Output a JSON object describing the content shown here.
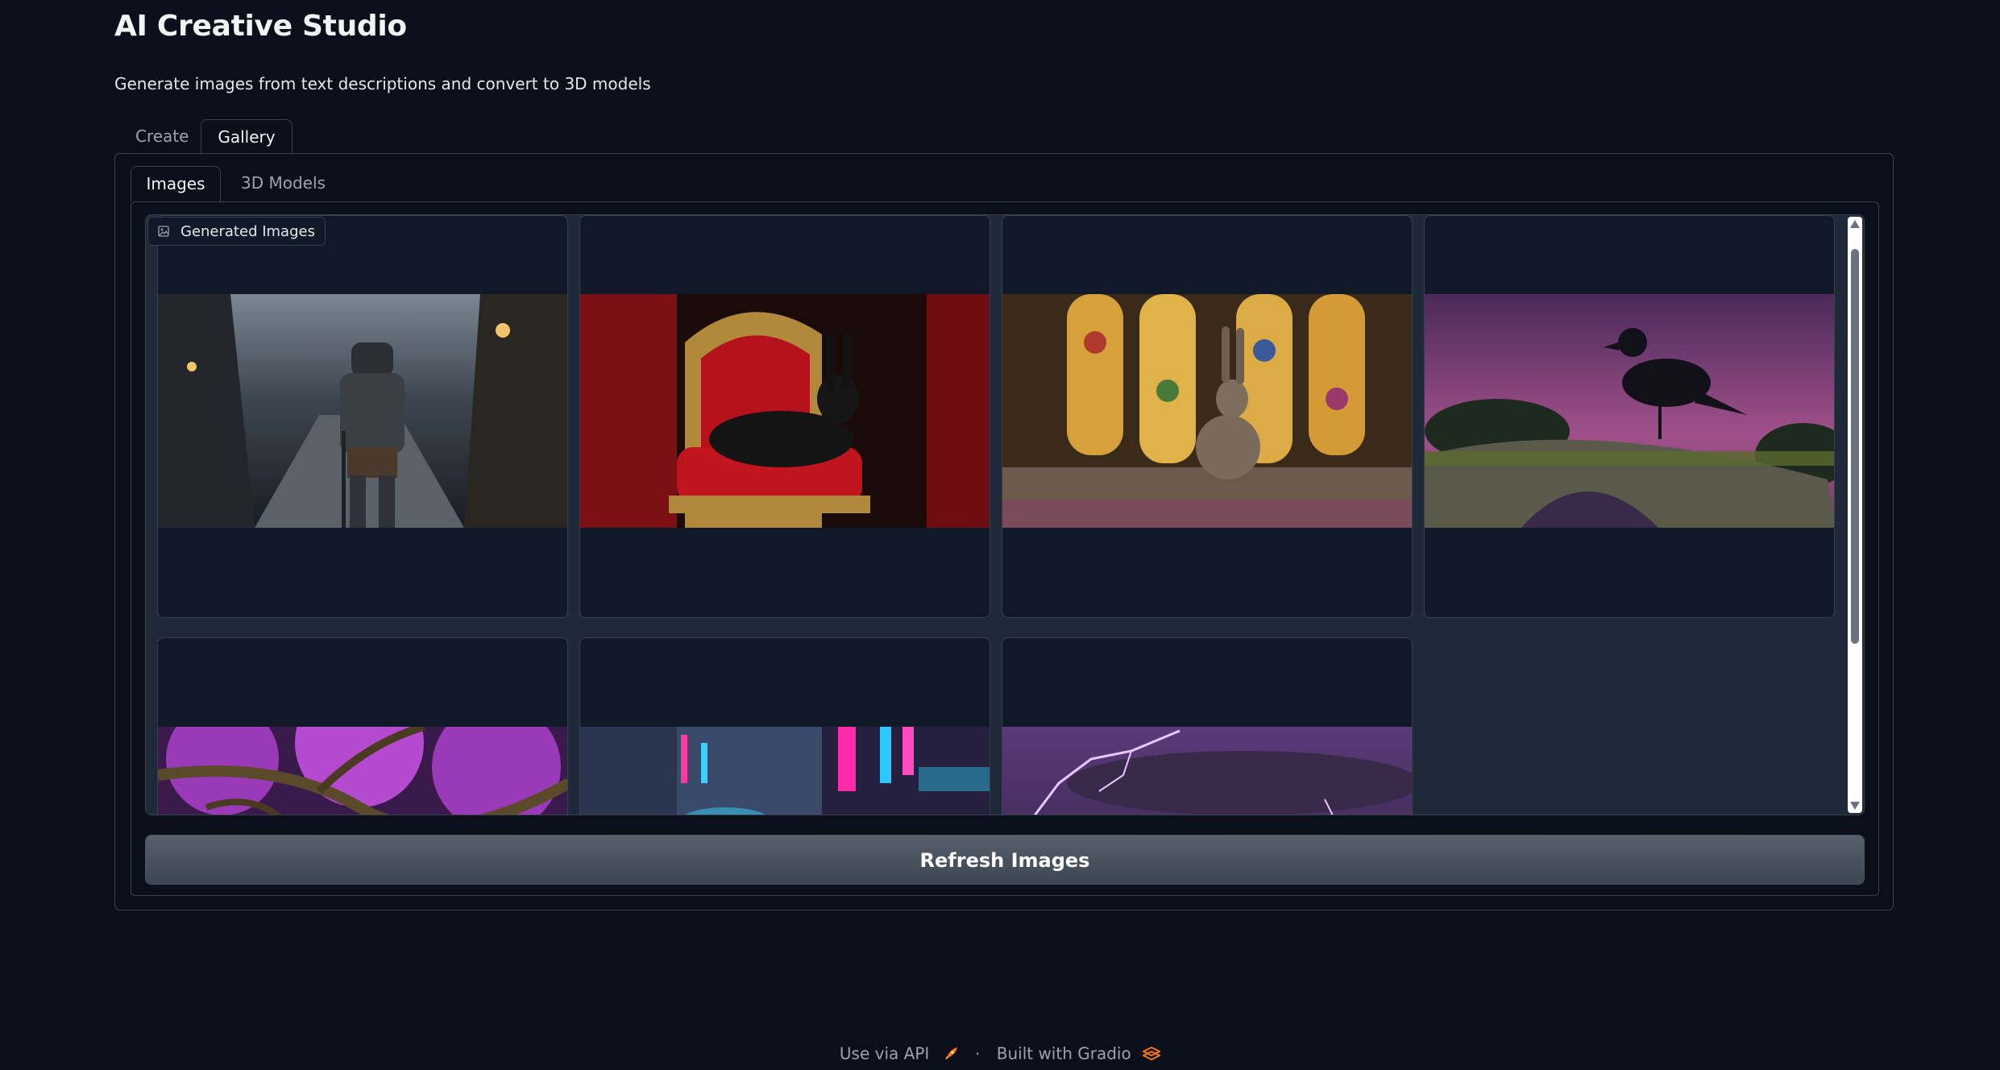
{
  "header": {
    "title": "AI Creative Studio",
    "description": "Generate images from text descriptions and convert to 3D models"
  },
  "tabs": [
    {
      "label": "Create",
      "selected": false
    },
    {
      "label": "Gallery",
      "selected": true
    }
  ],
  "gallery_tabs": [
    {
      "label": "Images",
      "selected": true
    },
    {
      "label": "3D Models",
      "selected": false
    }
  ],
  "gallery": {
    "label": "Generated Images",
    "label_icon": "image-icon",
    "items": [
      {
        "subject": "armored-knight-in-cobblestone-alley"
      },
      {
        "subject": "black-rabbit-on-red-throne"
      },
      {
        "subject": "rabbit-before-stained-glass-windows"
      },
      {
        "subject": "raven-on-mossy-stone-bridge"
      },
      {
        "subject": "purple-blossom-tree-branches"
      },
      {
        "subject": "neon-city-street-at-night"
      },
      {
        "subject": "purple-lightning-storm"
      }
    ]
  },
  "actions": {
    "refresh_label": "Refresh Images"
  },
  "footer": {
    "api_label": "Use via API",
    "separator": "·",
    "built_with": "Built with Gradio"
  },
  "colors": {
    "background": "#0b0f19",
    "panel_border": "#374151",
    "gallery_bg": "#1f2937",
    "button_bg": "#4b5563",
    "gradio_orange": "#f97316"
  }
}
